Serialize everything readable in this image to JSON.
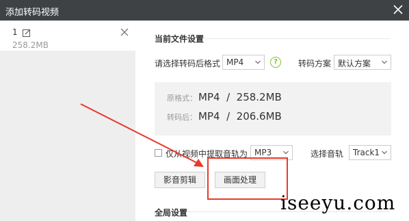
{
  "window": {
    "title": "添加转码视频"
  },
  "file_list": [
    {
      "index": "1",
      "size": "258.2MB"
    }
  ],
  "current_settings": {
    "title": "当前文件设置",
    "format_label": "请选择转码后格式",
    "format_value": "MP4",
    "scheme_label": "转码方案",
    "scheme_value": "默认方案",
    "original_label": "原格式：",
    "original_value": "MP4  /  258.2MB",
    "converted_label": "转码后：",
    "converted_value": "MP4  /  206.6MB",
    "audio_only_label": "仅从视频中提取音轨为",
    "audio_format_value": "MP3",
    "track_label": "选择音轨",
    "track_value": "Track1",
    "edit_button": "影音剪辑",
    "picture_button": "画面处理"
  },
  "global_settings": {
    "title": "全局设置"
  },
  "watermark": "iseeyu.com",
  "colors": {
    "titlebar": "#3f4245",
    "annotation": "#e8392d",
    "help_icon": "#7fbf2e"
  }
}
